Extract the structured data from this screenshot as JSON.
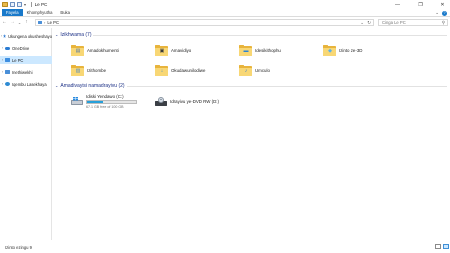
{
  "window": {
    "title": "Le PC",
    "minimize_glyph": "—",
    "maximize_glyph": "❐",
    "close_glyph": "✕"
  },
  "ribbon": {
    "tabs": [
      {
        "label": "Fayela"
      },
      {
        "label": "Khomphyutha"
      },
      {
        "label": "Buka"
      }
    ],
    "collapse_glyph": "⌄",
    "help_glyph": "?"
  },
  "nav": {
    "back_glyph": "←",
    "forward_glyph": "→",
    "recent_glyph": "⌄",
    "up_glyph": "↑"
  },
  "address": {
    "separator": "›",
    "crumb": "Le PC",
    "dropdown_glyph": "⌄",
    "refresh_glyph": "↻"
  },
  "search": {
    "placeholder": "Cinga Le PC",
    "icon_glyph": "⚲"
  },
  "sidebar": {
    "items": [
      {
        "label": "Ukungena okusheshayo",
        "icon": "star-icon",
        "color": "#2f7bd4"
      },
      {
        "label": "OneDrive",
        "icon": "cloud-icon",
        "color": "#2b7cd3"
      },
      {
        "label": "Le PC",
        "icon": "computer-icon",
        "color": "#3d8ee0"
      },
      {
        "label": "Inethiwekhi",
        "icon": "network-icon",
        "color": "#4a8fd8"
      },
      {
        "label": "Iqembu Lasekhaya",
        "icon": "homegroup-icon",
        "color": "#2e8bd3"
      }
    ],
    "expand_glyph": "›"
  },
  "folders_group": {
    "header": "Izikhwama (7)",
    "chevron": "⌄",
    "items": [
      {
        "label": "Amadokhumenti",
        "icon": "documents-folder-icon",
        "glyph": "▤",
        "glyph_color": "#5b7ea6"
      },
      {
        "label": "Amavidiyo",
        "icon": "videos-folder-icon",
        "glyph": "▣",
        "glyph_color": "#3a3a3a"
      },
      {
        "label": "Idesikithophu",
        "icon": "desktop-folder-icon",
        "glyph": "▬",
        "glyph_color": "#2c84d4"
      },
      {
        "label": "Izinto ze-3D",
        "icon": "3d-objects-folder-icon",
        "glyph": "◆",
        "glyph_color": "#5ab3e8"
      },
      {
        "label": "Izithombe",
        "icon": "pictures-folder-icon",
        "glyph": "▨",
        "glyph_color": "#5b8fbf"
      },
      {
        "label": "Okudawunilodiwe",
        "icon": "downloads-folder-icon",
        "glyph": "↓",
        "glyph_color": "#1f78d1"
      },
      {
        "label": "Umculo",
        "icon": "music-folder-icon",
        "glyph": "♪",
        "glyph_color": "#2f7bd4"
      }
    ]
  },
  "drives_group": {
    "header": "Amadivayisi namadrayivu (2)",
    "chevron": "⌄",
    "items": [
      {
        "label": "Idiski Yendawo (C:)",
        "icon": "local-disk-icon",
        "free_text": "67.1 GB free of 100 GB",
        "used_fraction": 0.329
      },
      {
        "label": "Idrayivu ye-DVD RW (D:)",
        "icon": "dvd-drive-icon"
      }
    ]
  },
  "status": {
    "text": "Izinto ezingu 9"
  }
}
